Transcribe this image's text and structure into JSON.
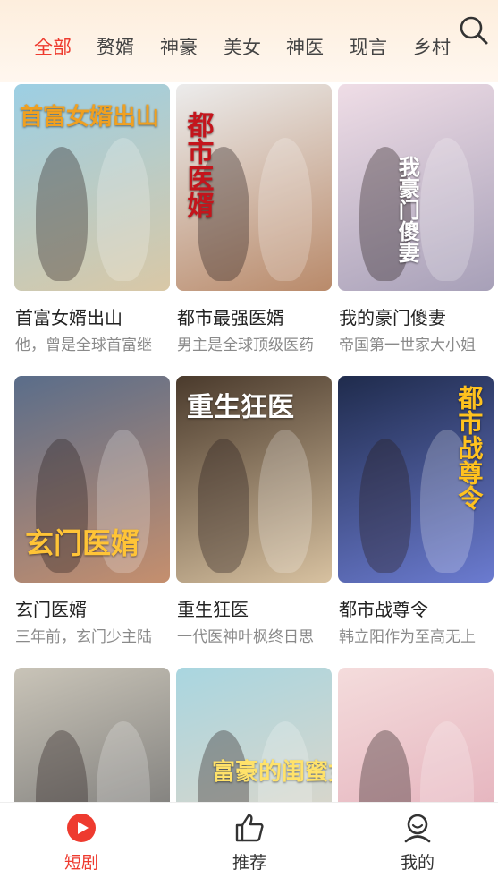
{
  "categories": [
    {
      "label": "全部",
      "active": true
    },
    {
      "label": "赘婿"
    },
    {
      "label": "神豪"
    },
    {
      "label": "美女"
    },
    {
      "label": "神医"
    },
    {
      "label": "现言"
    },
    {
      "label": "乡村"
    }
  ],
  "search_icon": "search-icon",
  "dramas": [
    {
      "name": "首富女婿出山",
      "desc": "他，曾是全球首富继",
      "poster_text": "首富女婿出山",
      "colors": [
        "#9ccfe4",
        "#d9c8a6"
      ]
    },
    {
      "name": "都市最强医婿",
      "desc": "男主是全球顶级医药",
      "poster_text": "都市医婿",
      "colors": [
        "#ececec",
        "#b98a6a"
      ]
    },
    {
      "name": "我的豪门傻妻",
      "desc": "帝国第一世家大小姐",
      "poster_text": "我豪门傻妻",
      "colors": [
        "#efdde6",
        "#a7a0b8"
      ]
    },
    {
      "name": "玄门医婿",
      "desc": "三年前，玄门少主陆",
      "poster_text": "玄门医婿",
      "colors": [
        "#5a6d8a",
        "#c58f6e"
      ]
    },
    {
      "name": "重生狂医",
      "desc": "一代医神叶枫终日思",
      "poster_text": "重生狂医",
      "colors": [
        "#4a3a2c",
        "#d7c1a0"
      ]
    },
    {
      "name": "都市战尊令",
      "desc": "韩立阳作为至高无上",
      "poster_text": "都市战尊令",
      "colors": [
        "#1f2b4c",
        "#6b7bd0"
      ]
    },
    {
      "name": "",
      "desc": "",
      "poster_text": "",
      "colors": [
        "#c9c4b8",
        "#6c6c6c"
      ]
    },
    {
      "name": "",
      "desc": "",
      "poster_text": "富豪的闺蜜女神",
      "colors": [
        "#a9d6e0",
        "#e8d6c4"
      ]
    },
    {
      "name": "",
      "desc": "",
      "poster_text": "",
      "colors": [
        "#f4dcdc",
        "#e1a8b5"
      ]
    }
  ],
  "bottom_nav": [
    {
      "label": "短剧",
      "icon": "play-circle-icon",
      "active": true
    },
    {
      "label": "推荐",
      "icon": "thumbs-up-icon"
    },
    {
      "label": "我的",
      "icon": "user-icon"
    }
  ],
  "accent_color": "#ee3b2f"
}
